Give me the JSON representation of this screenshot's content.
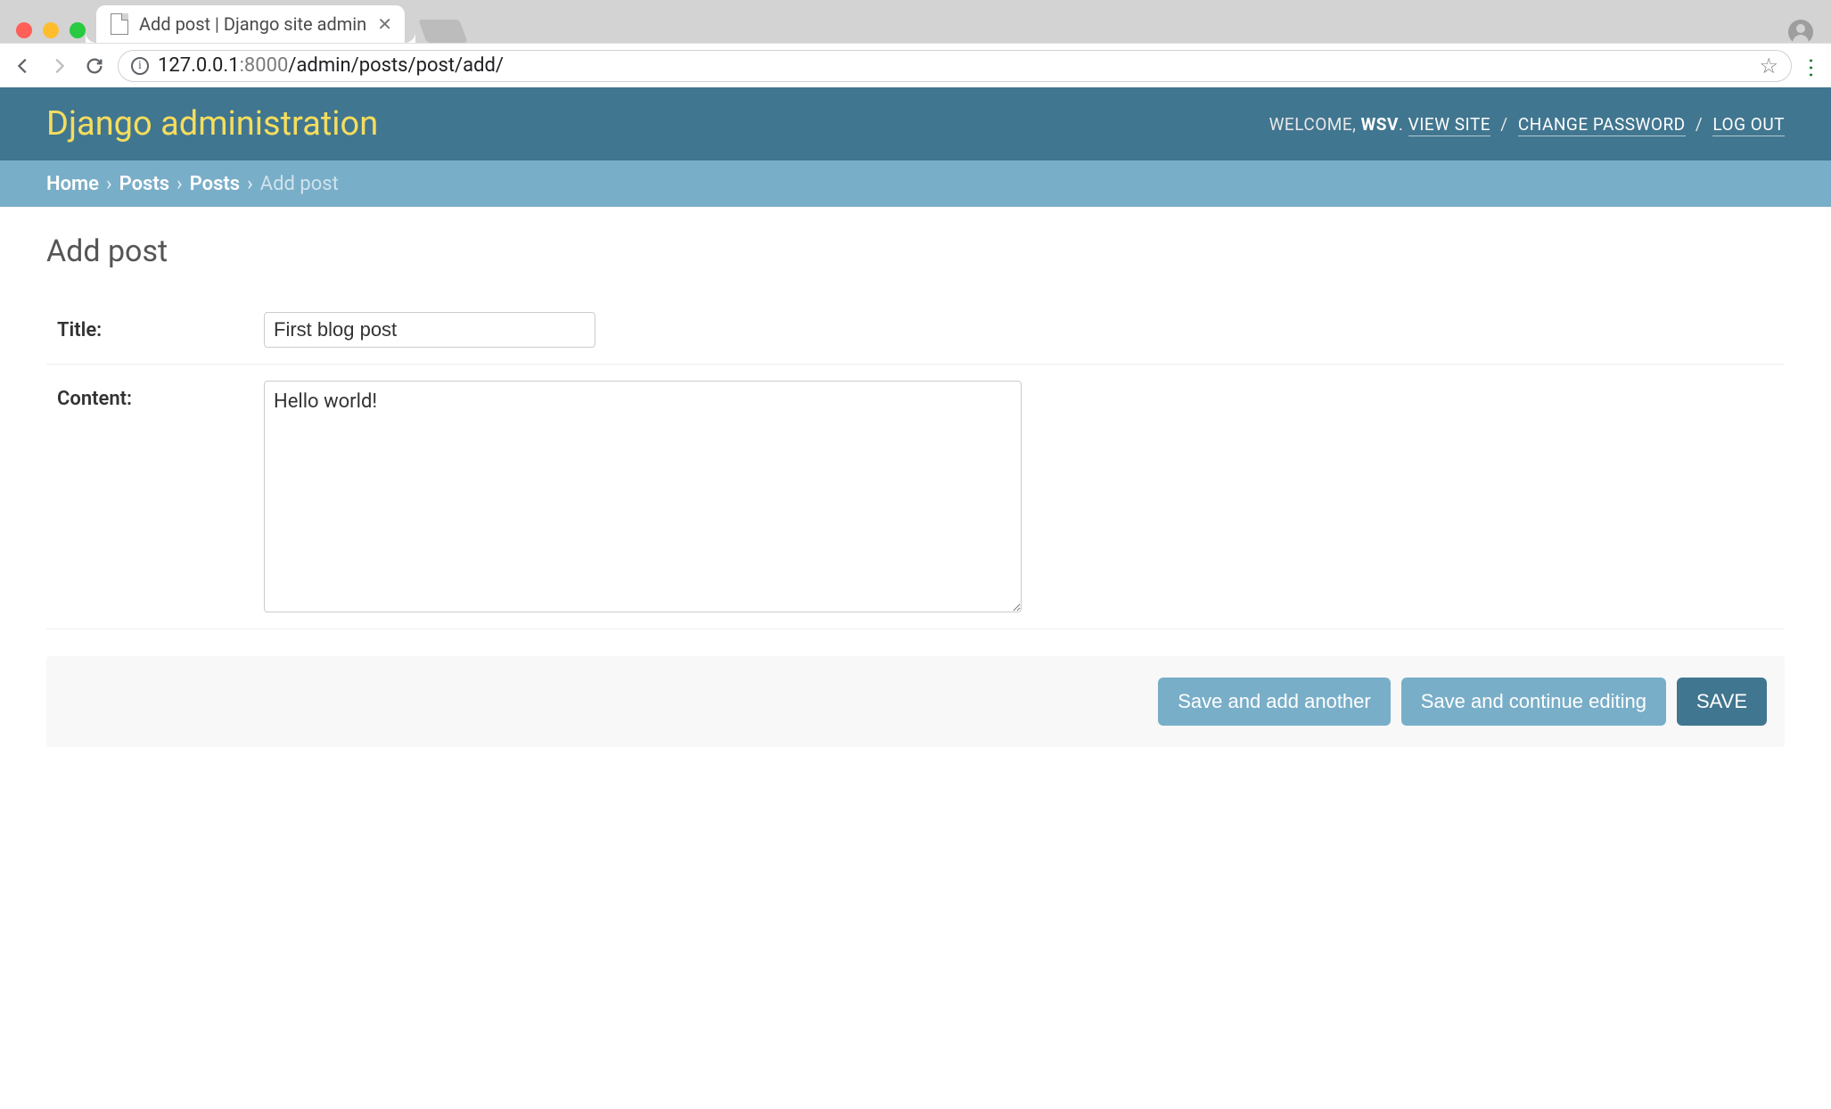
{
  "browser": {
    "tab_title": "Add post | Django site admin",
    "url_host": "127.0.0.1",
    "url_port": ":8000",
    "url_path": "/admin/posts/post/add/"
  },
  "header": {
    "site_title": "Django administration",
    "welcome_label": "WELCOME,",
    "username": "WSV",
    "view_site": "VIEW SITE",
    "change_password": "CHANGE PASSWORD",
    "log_out": "LOG OUT"
  },
  "breadcrumbs": {
    "home": "Home",
    "app": "Posts",
    "model": "Posts",
    "current": "Add post"
  },
  "page": {
    "title": "Add post"
  },
  "form": {
    "title_label": "Title:",
    "title_value": "First blog post",
    "content_label": "Content:",
    "content_value": "Hello world!"
  },
  "buttons": {
    "save_add_another": "Save and add another",
    "save_continue": "Save and continue editing",
    "save": "SAVE"
  }
}
